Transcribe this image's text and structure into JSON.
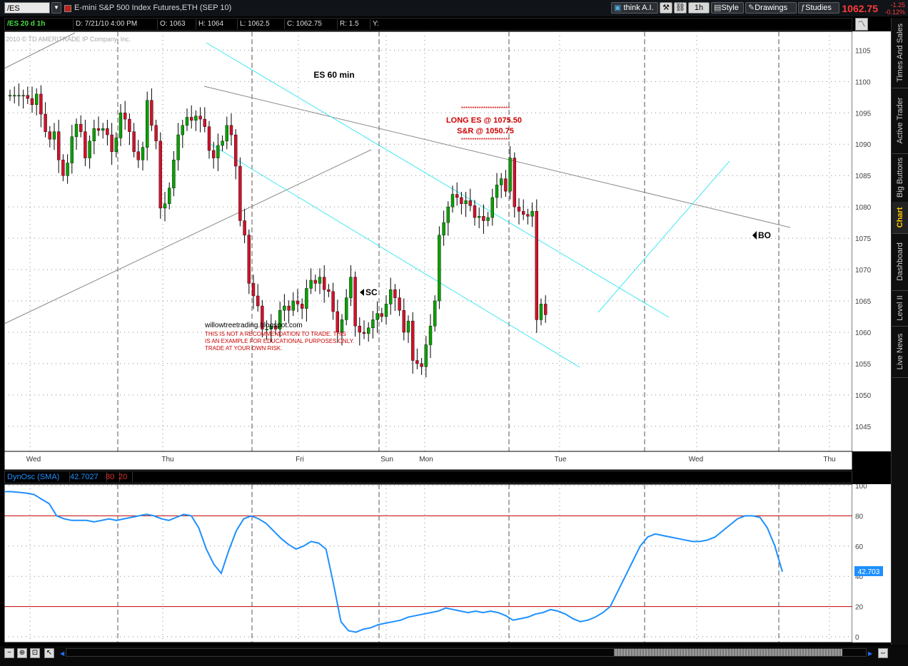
{
  "toolbar": {
    "symbol": "/ES",
    "title": "E-mini S&P 500 Index Futures,ETH (SEP 10)",
    "think_ai": "think A.I.",
    "timeframe": "1h",
    "style": "Style",
    "drawings": "Drawings",
    "studies": "Studies",
    "last_price": "1062.75",
    "net_change": "-1.25",
    "pct_change": "-0.12%"
  },
  "quote": {
    "symbol": "/ES 20 d 1h",
    "date": "D: 7/21/10 4:00 PM",
    "open": "O: 1063",
    "high": "H: 1064",
    "low": "L: 1062.5",
    "close": "C: 1062.75",
    "range": "R: 1.5",
    "y": "Y:"
  },
  "chart": {
    "copyright": "2010 © TD AMERITRADE IP Company, Inc.",
    "title_label": "ES 60 min",
    "trade_note": {
      "stars": "**********************",
      "line1": "LONG ES @ 1075.50",
      "line2": "S&R @ 1050.75"
    },
    "blog": "willowtreetrading.blogspot.com",
    "disclaimer": [
      "THIS IS NOT A RECOMMENDATION TO TRADE. THIS",
      "IS AN EXAMPLE FOR EDUCATIONAL PURPOSES ONLY.",
      "TRADE AT YOUR OWN RISK."
    ],
    "marker_sc": "SC",
    "marker_bo": "BO"
  },
  "study": {
    "name": "DynOsc (SMA)",
    "value": "42.7027",
    "upper": "80",
    "lower": "20",
    "badge": "42.703"
  },
  "side_tabs": [
    "Times And Sales",
    "Active Trader",
    "Big Buttons",
    "Chart",
    "Dashboard",
    "Level II",
    "Live News"
  ],
  "colors": {
    "up": "#0aa000",
    "down": "#d0122a",
    "trendline": "#40e8f0",
    "grey_line": "#8a8a8a",
    "osc": "#1e90ff",
    "ref": "#c00000"
  },
  "chart_data": [
    {
      "type": "candlestick",
      "title": "ES 60 min",
      "ylim": [
        1041,
        1108
      ],
      "price_ticks": [
        1045,
        1050,
        1055,
        1060,
        1065,
        1070,
        1075,
        1080,
        1085,
        1090,
        1095,
        1100,
        1105
      ],
      "day_labels": [
        "Wed",
        "Thu",
        "Fri",
        "Sun",
        "Mon",
        "Tue",
        "Wed",
        "Thu"
      ],
      "closes": [
        1097.8,
        1097.8,
        1097.8,
        1097.8,
        1097.3,
        1096.3,
        1098,
        1094.8,
        1092,
        1090.8,
        1092,
        1087.5,
        1085,
        1087,
        1091.2,
        1093.2,
        1092,
        1087.8,
        1090.5,
        1092.5,
        1092.2,
        1092.5,
        1091.5,
        1088.8,
        1091,
        1095,
        1094,
        1092,
        1088.8,
        1087.5,
        1089.5,
        1097,
        1093,
        1090.5,
        1079.8,
        1080.5,
        1083,
        1087.5,
        1091.5,
        1093,
        1094.3,
        1093.8,
        1094.5,
        1094,
        1092.8,
        1089,
        1087.8,
        1089.8,
        1090.5,
        1093,
        1091.5,
        1086.5,
        1077.8,
        1075.5,
        1067.8,
        1065.8,
        1064.2,
        1060.5,
        1060.5,
        1061,
        1060.5,
        1063.5,
        1064.2,
        1063.5,
        1065,
        1064.5,
        1063.8,
        1067,
        1068.3,
        1067.8,
        1068.8,
        1066.8,
        1066.5,
        1063.3,
        1060,
        1062,
        1065.5,
        1068.8,
        1061,
        1060,
        1059.8,
        1060.7,
        1062,
        1063,
        1062.5,
        1064.5,
        1066.8,
        1065.5,
        1063.5,
        1060,
        1061.8,
        1055.5,
        1055,
        1054.5,
        1058,
        1061,
        1065,
        1075.5,
        1077.5,
        1080,
        1082,
        1081.5,
        1080.5,
        1081,
        1080.2,
        1078.3,
        1078.5,
        1077.8,
        1078.3,
        1081.5,
        1083.5,
        1084.5,
        1082.5,
        1087.8,
        1080,
        1079.3,
        1078.8,
        1078.5,
        1079.3,
        1062,
        1064.5,
        1062.8
      ],
      "osc_ylim": [
        0,
        100
      ],
      "osc_ticks": [
        0,
        20,
        40,
        60,
        80,
        100
      ],
      "osc_values": [
        96,
        96,
        95.5,
        95,
        94,
        91,
        88,
        80,
        78,
        77,
        77,
        77,
        76,
        77,
        78,
        77,
        78,
        79,
        80,
        81,
        80,
        78,
        77,
        79,
        81,
        80,
        72,
        58,
        48,
        42,
        57,
        70,
        78,
        80,
        78,
        75,
        70,
        65,
        61,
        58,
        60,
        63,
        62,
        58,
        35,
        10,
        4,
        3,
        5,
        6,
        8,
        9,
        10,
        11,
        13,
        14,
        15,
        16,
        17,
        19,
        18,
        17,
        16,
        17,
        16,
        17,
        16,
        14,
        11,
        12,
        13,
        15,
        16,
        18,
        17,
        15,
        12,
        10,
        11,
        13,
        16,
        20,
        30,
        40,
        50,
        60,
        66,
        68,
        67,
        66,
        65,
        64,
        63,
        63,
        64,
        66,
        70,
        74,
        78,
        80,
        80,
        79,
        72,
        60,
        43
      ]
    }
  ]
}
